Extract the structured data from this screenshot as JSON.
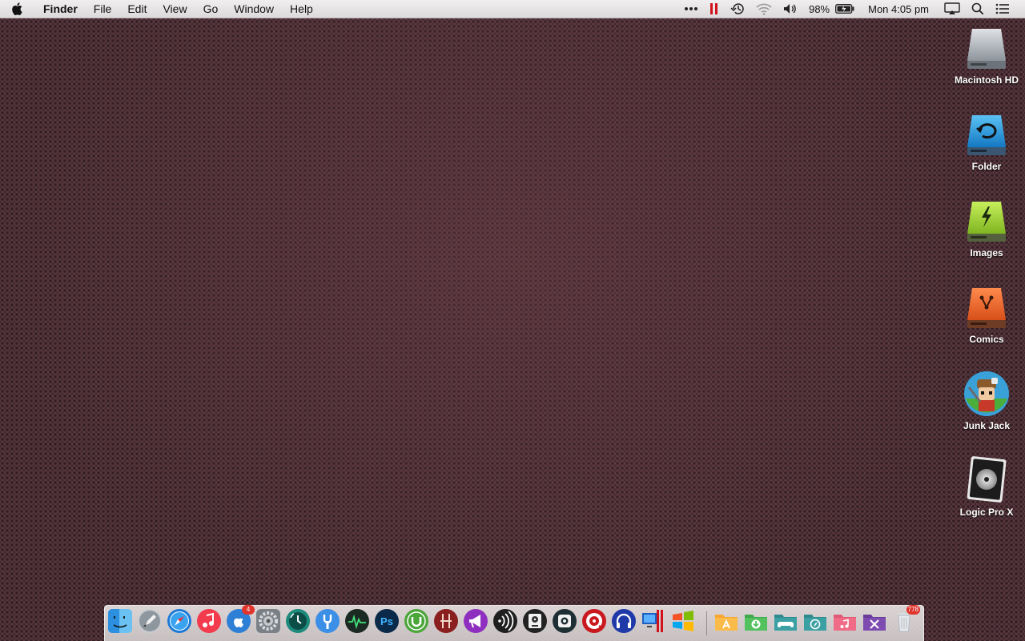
{
  "menubar": {
    "app_name": "Finder",
    "menus": [
      "File",
      "Edit",
      "View",
      "Go",
      "Window",
      "Help"
    ],
    "status": {
      "more_icon": "more-icon",
      "battery_percent": "98%",
      "clock": "Mon 4:05 pm"
    }
  },
  "desktop": {
    "items": [
      {
        "label": "Macintosh HD",
        "icon": "hard-drive-icon"
      },
      {
        "label": "Folder",
        "icon": "time-machine-drive-icon"
      },
      {
        "label": "Images",
        "icon": "thunderbolt-drive-icon"
      },
      {
        "label": "Comics",
        "icon": "network-drive-icon"
      },
      {
        "label": "Junk Jack",
        "icon": "junk-jack-app-icon"
      },
      {
        "label": "Logic Pro X",
        "icon": "logic-pro-x-icon"
      }
    ]
  },
  "dock": {
    "app_store_badge": "4",
    "trash_badge": "778",
    "accent_colors": {
      "music": "#f23b4c",
      "safari": "#1a7ad8",
      "photoshop": "#0b2a4a",
      "utorrent": "#4ba63a",
      "onyx": "#8a1f1f",
      "folder_orange": "#f6a631",
      "folder_green": "#52c15e",
      "folder_teal": "#3aa0a3",
      "folder_pink": "#ef6b86",
      "folder_purple": "#7e4cb0"
    }
  }
}
